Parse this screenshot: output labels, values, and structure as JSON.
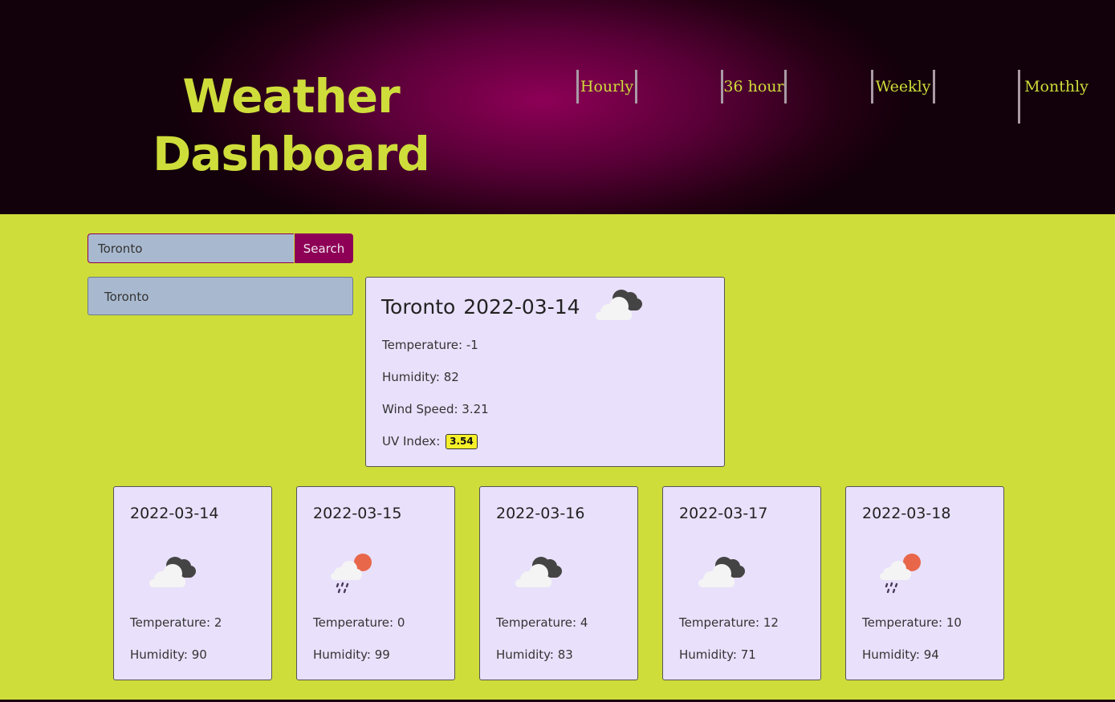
{
  "header": {
    "title_line1": "Weather",
    "title_line2": "Dashboard",
    "nav": [
      "Hourly",
      "36 hour",
      "Weekly",
      "Monthly"
    ]
  },
  "search": {
    "value": "Toronto",
    "button_label": "Search"
  },
  "history": [
    "Toronto"
  ],
  "current": {
    "city": "Toronto",
    "date": "2022-03-14",
    "icon": "cloudy-icon",
    "temperature_label": "Temperature: -1",
    "humidity_label": "Humidity: 82",
    "wind_label": "Wind Speed: 3.21",
    "uv_label": "UV Index:",
    "uv_value": "3.54"
  },
  "forecast": [
    {
      "date": "2022-03-14",
      "icon": "cloudy-icon",
      "temperature": "Temperature: 2",
      "humidity": "Humidity: 90"
    },
    {
      "date": "2022-03-15",
      "icon": "rain-sun-icon",
      "temperature": "Temperature: 0",
      "humidity": "Humidity: 99"
    },
    {
      "date": "2022-03-16",
      "icon": "cloudy-icon",
      "temperature": "Temperature: 4",
      "humidity": "Humidity: 83"
    },
    {
      "date": "2022-03-17",
      "icon": "cloudy-icon",
      "temperature": "Temperature: 12",
      "humidity": "Humidity: 71"
    },
    {
      "date": "2022-03-18",
      "icon": "rain-sun-icon",
      "temperature": "Temperature: 10",
      "humidity": "Humidity: 94"
    }
  ],
  "colors": {
    "accent": "#8d0056",
    "background": "#cfdd3a",
    "card": "#e9e0fb",
    "uv_badge": "#f6f02a"
  }
}
